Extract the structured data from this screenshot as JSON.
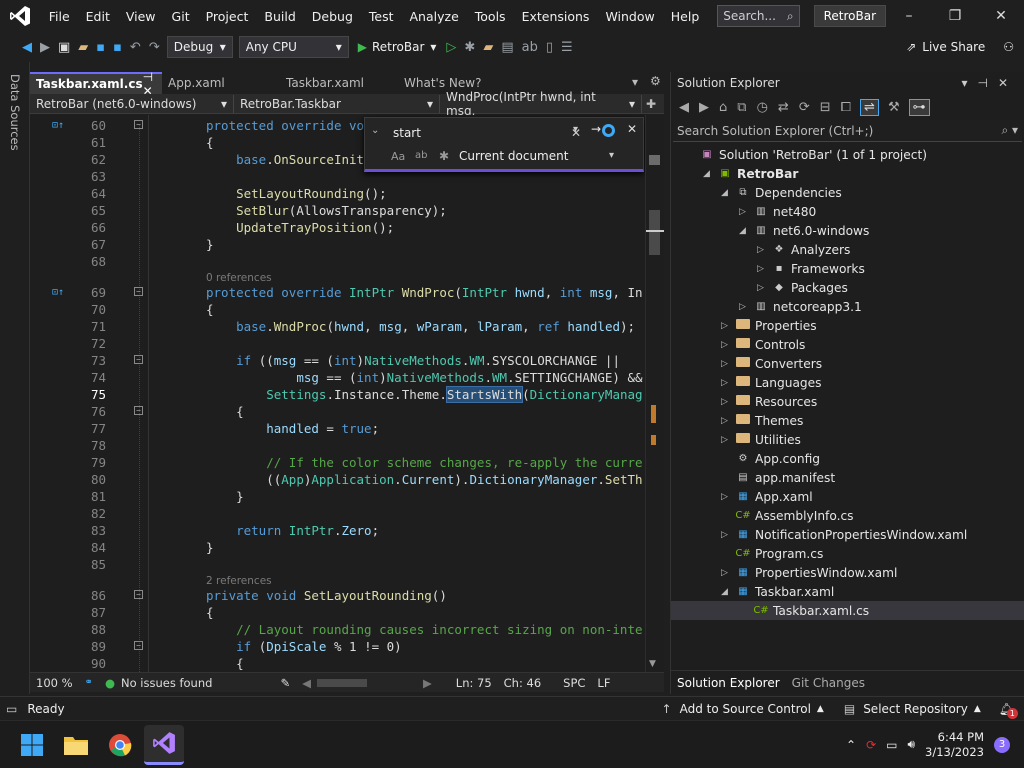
{
  "menu": {
    "items": [
      "File",
      "Edit",
      "View",
      "Git",
      "Project",
      "Build",
      "Debug",
      "Test",
      "Analyze",
      "Tools",
      "Extensions",
      "Window",
      "Help"
    ],
    "search_placeholder": "Search...",
    "solution_name": "RetroBar"
  },
  "toolbar": {
    "config": "Debug",
    "platform": "Any CPU",
    "start_target": "RetroBar",
    "live_share": "Live Share"
  },
  "left_strip": {
    "label": "Data Sources"
  },
  "doc_tabs": [
    {
      "label": "Taskbar.xaml.cs",
      "active": true
    },
    {
      "label": "App.xaml",
      "active": false
    },
    {
      "label": "Taskbar.xaml",
      "active": false
    },
    {
      "label": "What's New?",
      "active": false
    }
  ],
  "nav": {
    "project": "RetroBar (net6.0-windows)",
    "type": "RetroBar.Taskbar",
    "member": "WndProc(IntPtr hwnd, int msg,"
  },
  "find": {
    "query": "start",
    "scope": "Current document"
  },
  "code": [
    {
      "n": "60",
      "tokens": [
        [
          "k",
          "protected "
        ],
        [
          "k",
          "override "
        ],
        [
          "k",
          "vo"
        ]
      ],
      "fold": true,
      "mark": true
    },
    {
      "n": "61",
      "tokens": [
        [
          "s",
          "{"
        ]
      ]
    },
    {
      "n": "62",
      "tokens": [
        [
          "s",
          "    "
        ],
        [
          "k",
          "base"
        ],
        [
          "s",
          "."
        ],
        [
          "m",
          "OnSourceInit"
        ]
      ]
    },
    {
      "n": "63",
      "tokens": []
    },
    {
      "n": "64",
      "tokens": [
        [
          "s",
          "    "
        ],
        [
          "m",
          "SetLayoutRounding"
        ],
        [
          "s",
          "();"
        ]
      ]
    },
    {
      "n": "65",
      "tokens": [
        [
          "s",
          "    "
        ],
        [
          "m",
          "SetBlur"
        ],
        [
          "s",
          "(AllowsTransparency);"
        ]
      ]
    },
    {
      "n": "66",
      "tokens": [
        [
          "s",
          "    "
        ],
        [
          "m",
          "UpdateTrayPosition"
        ],
        [
          "s",
          "();"
        ]
      ]
    },
    {
      "n": "67",
      "tokens": [
        [
          "s",
          "}"
        ]
      ]
    },
    {
      "n": "68",
      "tokens": []
    },
    {
      "n": "69",
      "tokens": [
        [
          "k",
          "protected "
        ],
        [
          "k",
          "override "
        ],
        [
          "t",
          "IntPtr "
        ],
        [
          "m",
          "WndProc"
        ],
        [
          "s",
          "("
        ],
        [
          "t",
          "IntPtr "
        ],
        [
          "p",
          "hwnd"
        ],
        [
          "s",
          ", "
        ],
        [
          "k",
          "int "
        ],
        [
          "p",
          "msg"
        ],
        [
          "s",
          ", In"
        ]
      ],
      "fold": true,
      "mark": true,
      "ref": "0 references"
    },
    {
      "n": "70",
      "tokens": [
        [
          "s",
          "{"
        ]
      ]
    },
    {
      "n": "71",
      "tokens": [
        [
          "s",
          "    "
        ],
        [
          "k",
          "base"
        ],
        [
          "s",
          "."
        ],
        [
          "m",
          "WndProc"
        ],
        [
          "s",
          "("
        ],
        [
          "p",
          "hwnd"
        ],
        [
          "s",
          ", "
        ],
        [
          "p",
          "msg"
        ],
        [
          "s",
          ", "
        ],
        [
          "p",
          "wParam"
        ],
        [
          "s",
          ", "
        ],
        [
          "p",
          "lParam"
        ],
        [
          "s",
          ", "
        ],
        [
          "k",
          "ref "
        ],
        [
          "p",
          "handled"
        ],
        [
          "s",
          ");"
        ]
      ]
    },
    {
      "n": "72",
      "tokens": []
    },
    {
      "n": "73",
      "tokens": [
        [
          "s",
          "    "
        ],
        [
          "k",
          "if "
        ],
        [
          "s",
          "(("
        ],
        [
          "p",
          "msg"
        ],
        [
          "s",
          " == ("
        ],
        [
          "k",
          "int"
        ],
        [
          "s",
          ")"
        ],
        [
          "t",
          "NativeMethods"
        ],
        [
          "s",
          "."
        ],
        [
          "t",
          "WM"
        ],
        [
          "s",
          ".SYSCOLORCHANGE ||"
        ]
      ],
      "fold": true
    },
    {
      "n": "74",
      "tokens": [
        [
          "s",
          "            "
        ],
        [
          "p",
          "msg"
        ],
        [
          "s",
          " == ("
        ],
        [
          "k",
          "int"
        ],
        [
          "s",
          ")"
        ],
        [
          "t",
          "NativeMethods"
        ],
        [
          "s",
          "."
        ],
        [
          "t",
          "WM"
        ],
        [
          "s",
          ".SETTINGCHANGE) &&"
        ]
      ]
    },
    {
      "n": "75",
      "tokens": [
        [
          "s",
          "        "
        ],
        [
          "t",
          "Settings"
        ],
        [
          "s",
          ".Instance.Theme."
        ],
        [
          "hl",
          "StartsWith"
        ],
        [
          "s",
          "("
        ],
        [
          "t",
          "DictionaryManag"
        ]
      ],
      "current": true
    },
    {
      "n": "76",
      "tokens": [
        [
          "s",
          "    {"
        ]
      ],
      "fold": true
    },
    {
      "n": "77",
      "tokens": [
        [
          "s",
          "        "
        ],
        [
          "p",
          "handled"
        ],
        [
          "s",
          " = "
        ],
        [
          "k",
          "true"
        ],
        [
          "s",
          ";"
        ]
      ]
    },
    {
      "n": "78",
      "tokens": []
    },
    {
      "n": "79",
      "tokens": [
        [
          "s",
          "        "
        ],
        [
          "c",
          "// If the color scheme changes, re-apply the curre"
        ]
      ]
    },
    {
      "n": "80",
      "tokens": [
        [
          "s",
          "        (("
        ],
        [
          "t",
          "App"
        ],
        [
          "s",
          ")"
        ],
        [
          "t",
          "Application"
        ],
        [
          "s",
          "."
        ],
        [
          "p",
          "Current"
        ],
        [
          "s",
          ")."
        ],
        [
          "p",
          "DictionaryManager"
        ],
        [
          "s",
          "."
        ],
        [
          "m",
          "SetTh"
        ]
      ]
    },
    {
      "n": "81",
      "tokens": [
        [
          "s",
          "    }"
        ]
      ]
    },
    {
      "n": "82",
      "tokens": []
    },
    {
      "n": "83",
      "tokens": [
        [
          "s",
          "    "
        ],
        [
          "k",
          "return "
        ],
        [
          "t",
          "IntPtr"
        ],
        [
          "s",
          "."
        ],
        [
          "p",
          "Zero"
        ],
        [
          "s",
          ";"
        ]
      ]
    },
    {
      "n": "84",
      "tokens": [
        [
          "s",
          "}"
        ]
      ]
    },
    {
      "n": "85",
      "tokens": []
    },
    {
      "n": "86",
      "tokens": [
        [
          "k",
          "private "
        ],
        [
          "k",
          "void "
        ],
        [
          "m",
          "SetLayoutRounding"
        ],
        [
          "s",
          "()"
        ]
      ],
      "fold": true,
      "ref": "2 references"
    },
    {
      "n": "87",
      "tokens": [
        [
          "s",
          "{"
        ]
      ]
    },
    {
      "n": "88",
      "tokens": [
        [
          "s",
          "    "
        ],
        [
          "c",
          "// Layout rounding causes incorrect sizing on non-inte"
        ]
      ]
    },
    {
      "n": "89",
      "tokens": [
        [
          "s",
          "    "
        ],
        [
          "k",
          "if "
        ],
        [
          "s",
          "("
        ],
        [
          "p",
          "DpiScale"
        ],
        [
          "s",
          " % 1 != 0)"
        ]
      ],
      "fold": true
    },
    {
      "n": "90",
      "tokens": [
        [
          "s",
          "    {"
        ]
      ]
    }
  ],
  "editor_status": {
    "zoom": "100 %",
    "issues": "No issues found",
    "ln": "Ln: 75",
    "ch": "Ch: 46",
    "ws": "SPC",
    "eol": "LF"
  },
  "solution_explorer": {
    "title": "Solution Explorer",
    "search_placeholder": "Search Solution Explorer (Ctrl+;)",
    "tabs": [
      "Solution Explorer",
      "Git Changes"
    ],
    "items": [
      {
        "label": "Solution 'RetroBar' (1 of 1 project)",
        "depth": 0,
        "arrow": "",
        "icon": "solution-icon",
        "bold": false
      },
      {
        "label": "RetroBar",
        "depth": 1,
        "arrow": "open",
        "icon": "csharp-project-icon",
        "bold": true
      },
      {
        "label": "Dependencies",
        "depth": 2,
        "arrow": "open",
        "icon": "dependencies-icon"
      },
      {
        "label": "net480",
        "depth": 3,
        "arrow": "closed",
        "icon": "framework-icon"
      },
      {
        "label": "net6.0-windows",
        "depth": 3,
        "arrow": "open",
        "icon": "framework-icon"
      },
      {
        "label": "Analyzers",
        "depth": 4,
        "arrow": "closed",
        "icon": "analyzer-icon"
      },
      {
        "label": "Frameworks",
        "depth": 4,
        "arrow": "closed",
        "icon": "frameworks-icon"
      },
      {
        "label": "Packages",
        "depth": 4,
        "arrow": "closed",
        "icon": "packages-icon"
      },
      {
        "label": "netcoreapp3.1",
        "depth": 3,
        "arrow": "closed",
        "icon": "framework-icon"
      },
      {
        "label": "Properties",
        "depth": 2,
        "arrow": "closed",
        "icon": "folder-icon"
      },
      {
        "label": "Controls",
        "depth": 2,
        "arrow": "closed",
        "icon": "folder-icon"
      },
      {
        "label": "Converters",
        "depth": 2,
        "arrow": "closed",
        "icon": "folder-icon"
      },
      {
        "label": "Languages",
        "depth": 2,
        "arrow": "closed",
        "icon": "folder-icon"
      },
      {
        "label": "Resources",
        "depth": 2,
        "arrow": "closed",
        "icon": "folder-icon"
      },
      {
        "label": "Themes",
        "depth": 2,
        "arrow": "closed",
        "icon": "folder-icon"
      },
      {
        "label": "Utilities",
        "depth": 2,
        "arrow": "closed",
        "icon": "folder-icon"
      },
      {
        "label": "App.config",
        "depth": 2,
        "arrow": "",
        "icon": "config-icon"
      },
      {
        "label": "app.manifest",
        "depth": 2,
        "arrow": "",
        "icon": "manifest-icon"
      },
      {
        "label": "App.xaml",
        "depth": 2,
        "arrow": "closed",
        "icon": "xaml-icon"
      },
      {
        "label": "AssemblyInfo.cs",
        "depth": 2,
        "arrow": "",
        "icon": "csharp-file-icon"
      },
      {
        "label": "NotificationPropertiesWindow.xaml",
        "depth": 2,
        "arrow": "closed",
        "icon": "xaml-icon"
      },
      {
        "label": "Program.cs",
        "depth": 2,
        "arrow": "",
        "icon": "csharp-file-icon"
      },
      {
        "label": "PropertiesWindow.xaml",
        "depth": 2,
        "arrow": "closed",
        "icon": "xaml-icon"
      },
      {
        "label": "Taskbar.xaml",
        "depth": 2,
        "arrow": "open",
        "icon": "xaml-icon"
      },
      {
        "label": "Taskbar.xaml.cs",
        "depth": 3,
        "arrow": "",
        "icon": "csharp-file-icon",
        "selected": true
      }
    ]
  },
  "status": {
    "ready": "Ready",
    "source_control": "Add to Source Control",
    "repo": "Select Repository",
    "notif_count": "1"
  },
  "taskbar": {
    "time": "6:44 PM",
    "date": "3/13/2023",
    "notif": "3"
  },
  "colors": {
    "accent": "#6c4fd6",
    "keyword": "#569cd6",
    "type": "#4ec9b0",
    "method": "#dcdcaa",
    "comment": "#57a64a",
    "run": "#3fb950"
  }
}
